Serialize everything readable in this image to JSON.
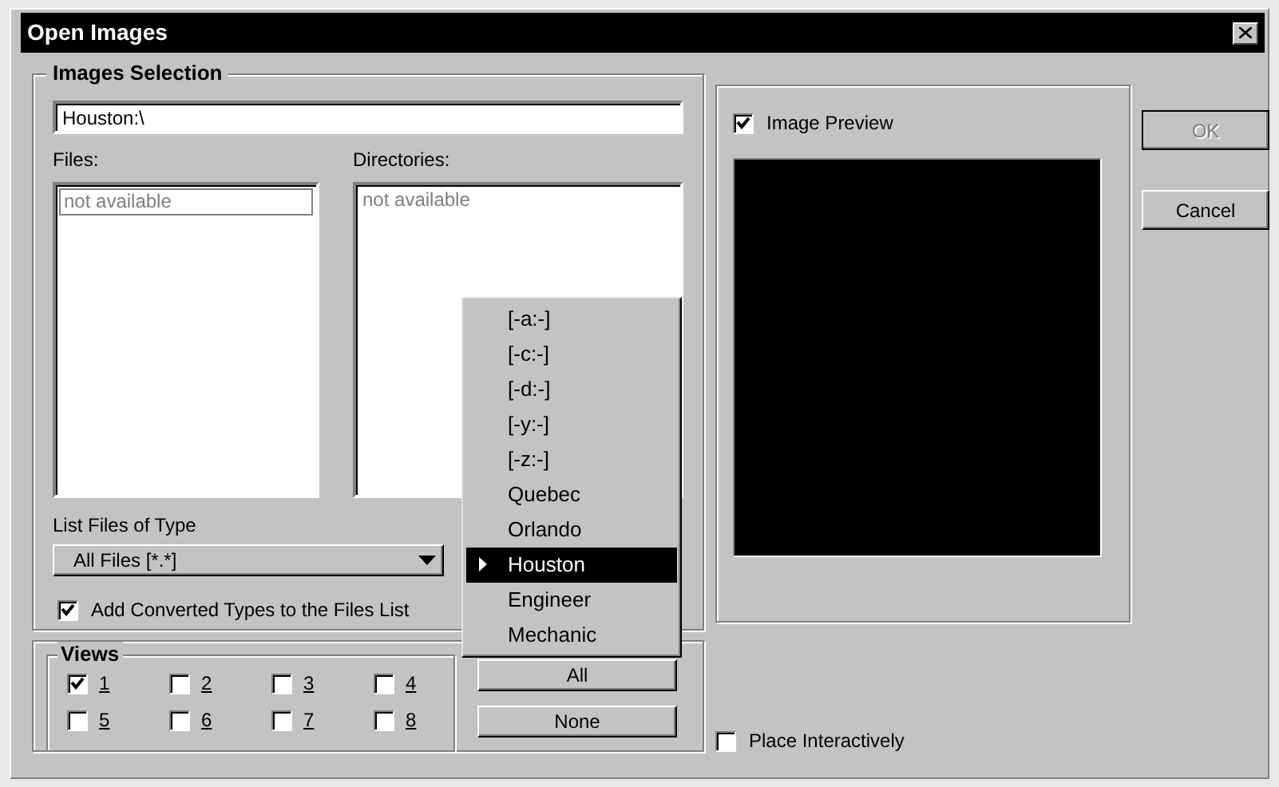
{
  "window": {
    "title": "Open Images"
  },
  "images_selection": {
    "title": "Images Selection",
    "path": "Houston:\\",
    "files_label": "Files:",
    "files": [
      "not available"
    ],
    "directories_label": "Directories:",
    "directories": [
      "not available"
    ],
    "file_type_label": "List Files of Type",
    "file_type": "All Files [*.*]",
    "add_converted": {
      "label": "Add Converted Types to the Files List",
      "checked": true
    }
  },
  "drive_menu": {
    "items": [
      {
        "label": "[-a:-]",
        "selected": false
      },
      {
        "label": "[-c:-]",
        "selected": false
      },
      {
        "label": "[-d:-]",
        "selected": false
      },
      {
        "label": "[-y:-]",
        "selected": false
      },
      {
        "label": "[-z:-]",
        "selected": false
      },
      {
        "label": "Quebec",
        "selected": false
      },
      {
        "label": "Orlando",
        "selected": false
      },
      {
        "label": "Houston",
        "selected": true
      },
      {
        "label": "Engineer",
        "selected": false
      },
      {
        "label": "Mechanic",
        "selected": false
      }
    ]
  },
  "views": {
    "title": "Views",
    "items": [
      {
        "label": "1",
        "checked": true
      },
      {
        "label": "2",
        "checked": false
      },
      {
        "label": "3",
        "checked": false
      },
      {
        "label": "4",
        "checked": false
      },
      {
        "label": "5",
        "checked": false
      },
      {
        "label": "6",
        "checked": false
      },
      {
        "label": "7",
        "checked": false
      },
      {
        "label": "8",
        "checked": false
      }
    ]
  },
  "view_buttons": [
    {
      "label": "All"
    },
    {
      "label": "None"
    }
  ],
  "preview": {
    "label": "Image Preview",
    "checked": true
  },
  "dialog_buttons": [
    {
      "label": "OK",
      "disabled": true
    },
    {
      "label": "Cancel",
      "disabled": false
    }
  ],
  "place_interactively": {
    "label": "Place Interactively",
    "checked": false
  }
}
